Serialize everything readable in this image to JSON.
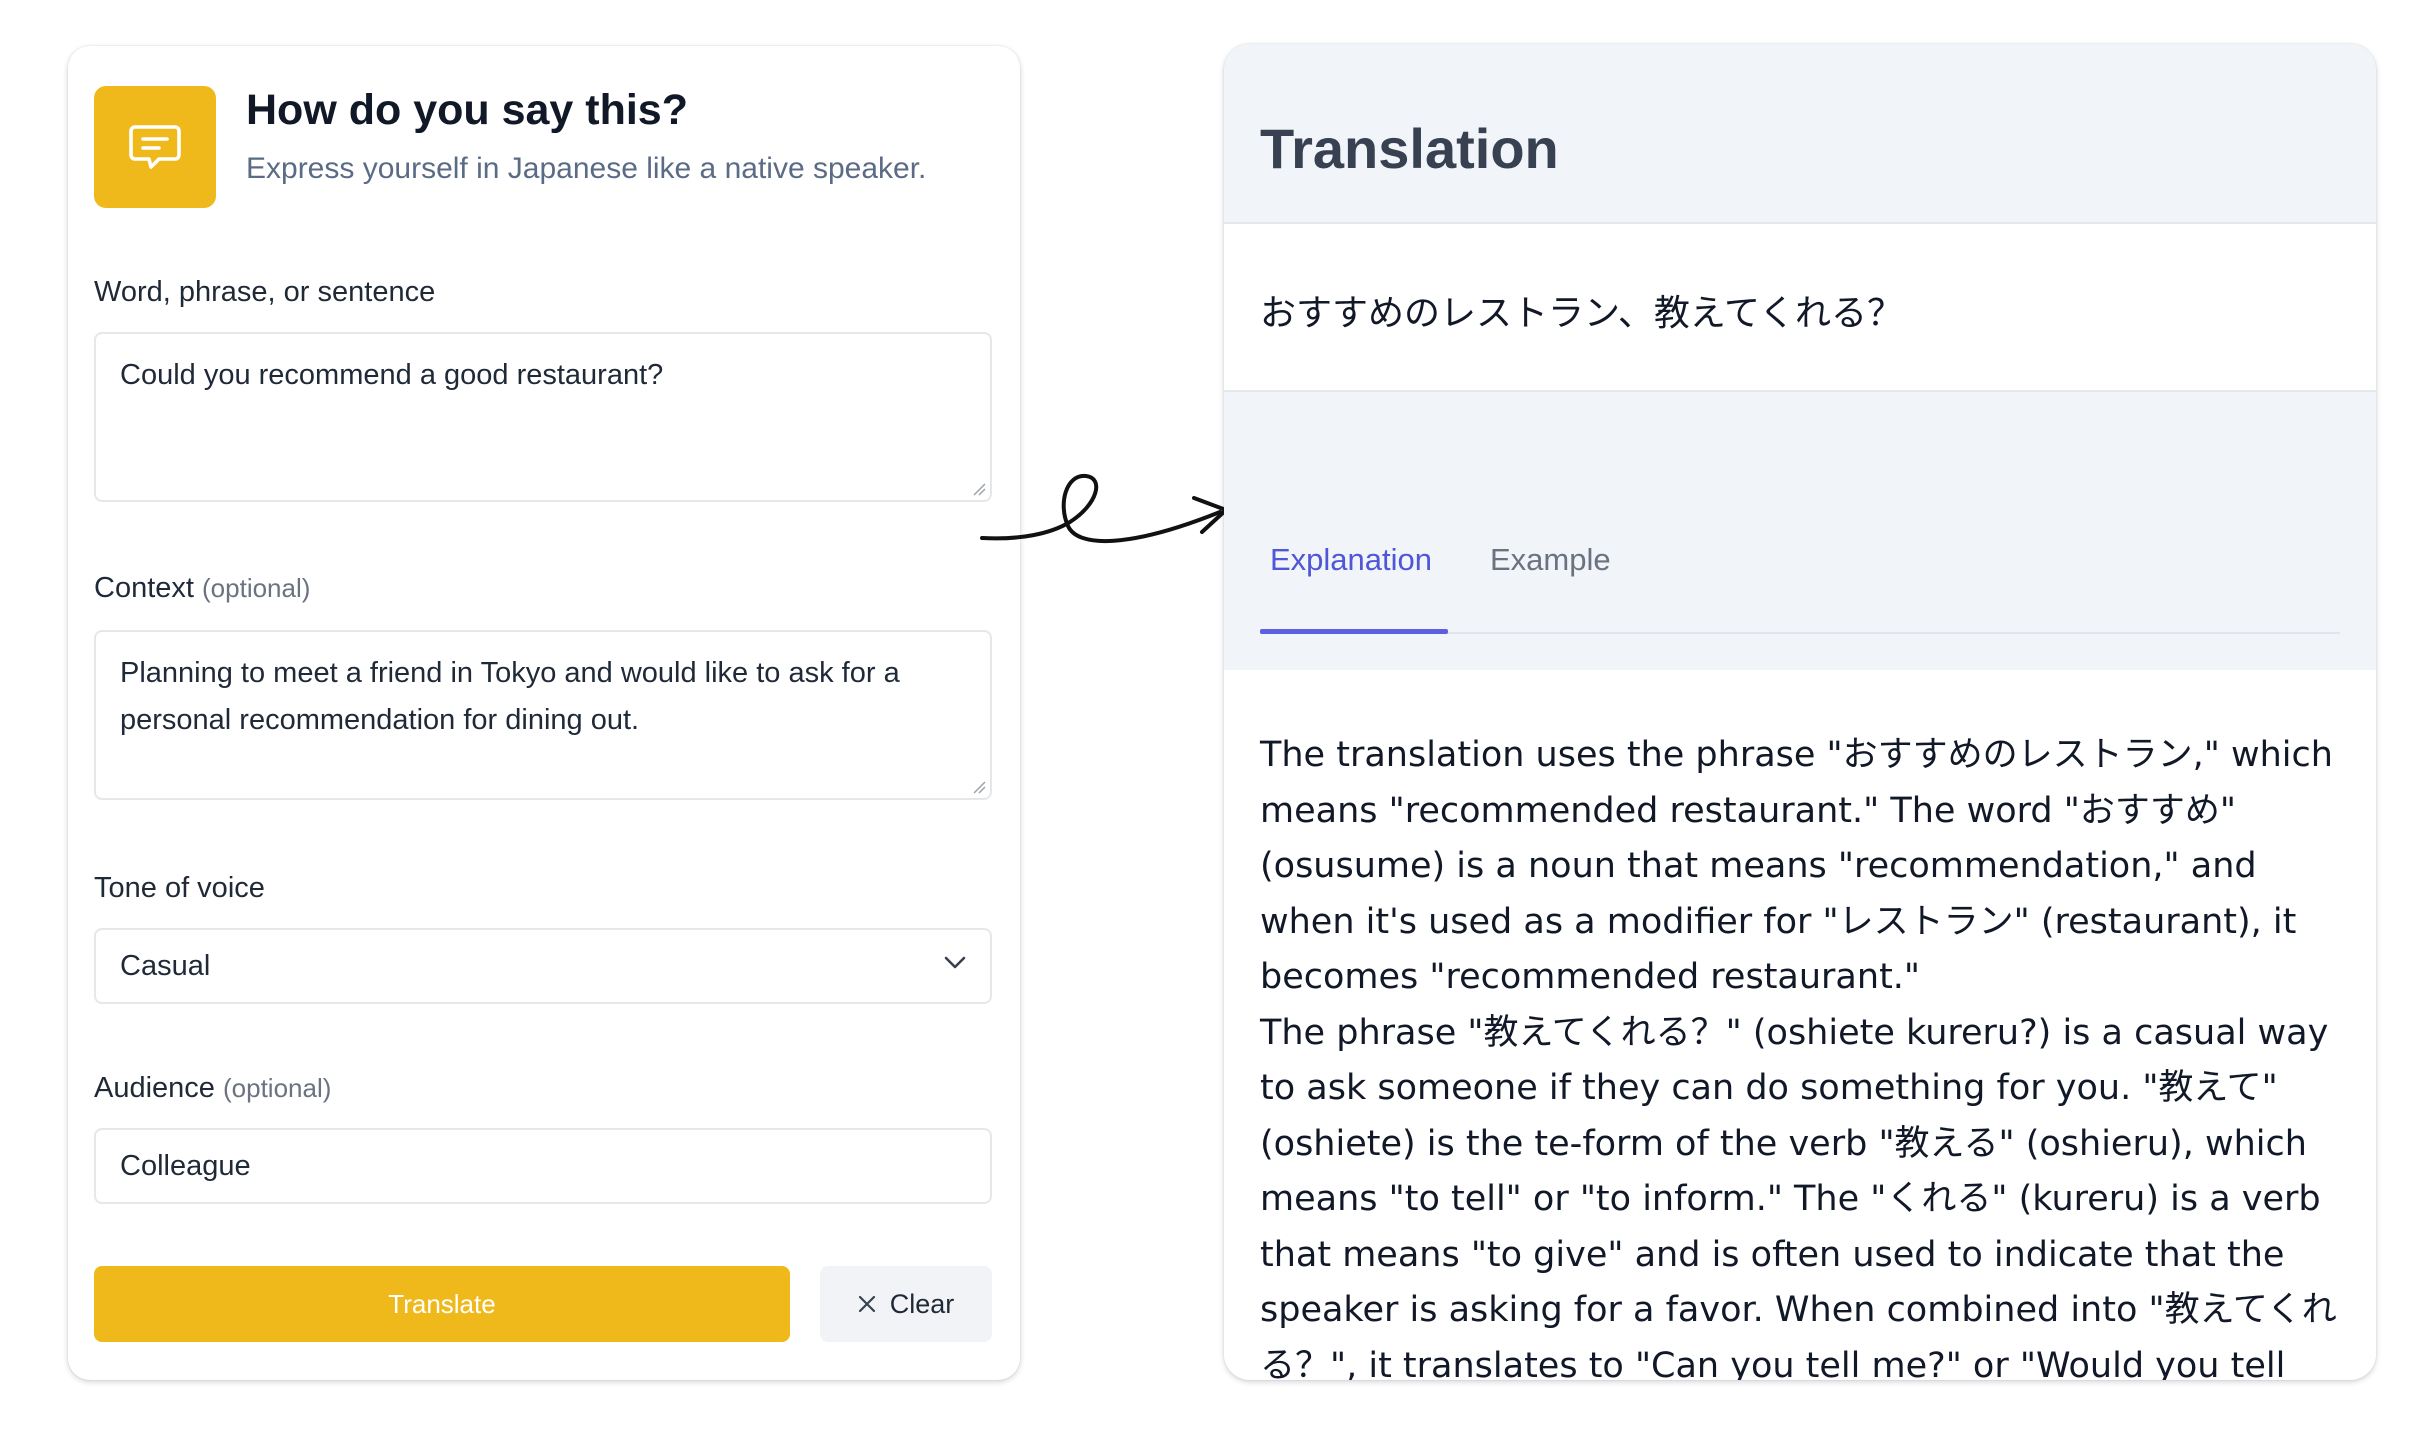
{
  "form": {
    "icon": "chat-bubble-icon",
    "title": "How do you say this?",
    "subtitle": "Express yourself in Japanese like a native speaker.",
    "phrase_label": "Word, phrase, or sentence",
    "phrase_value": "Could you recommend a good restaurant?",
    "context_label": "Context",
    "context_optional": "(optional)",
    "context_value": "Planning to meet a friend in Tokyo and would like to ask for a personal recommendation for dining out.",
    "tone_label": "Tone of voice",
    "tone_value": "Casual",
    "audience_label": "Audience",
    "audience_optional": "(optional)",
    "audience_value": "Colleague",
    "translate_label": "Translate",
    "clear_label": "Clear"
  },
  "result": {
    "title": "Translation",
    "translation": "おすすめのレストラン、教えてくれる？",
    "tabs": [
      {
        "label": "Explanation",
        "active": true
      },
      {
        "label": "Example",
        "active": false
      }
    ],
    "explanation": "The translation uses the phrase \"おすすめのレストラン,\" which means \"recommended restaurant.\" The word \"おすすめ\" (osusume) is a noun that means \"recommendation,\" and when it's used as a modifier for \"レストラン\" (restaurant), it becomes \"recommended restaurant.\"\nThe phrase \"教えてくれる？\" (oshiete kureru?) is a casual way to ask someone if they can do something for you. \"教えて\" (oshiete) is the te-form of the verb \"教える\" (oshieru), which means \"to tell\" or \"to inform.\" The \"くれる\" (kureru) is a verb that means \"to give\" and is often used to indicate that the speaker is asking for a favor. When combined into \"教えてくれる？\", it translates to \"Can you tell me?\" or \"Would you tell me?\" in a casual request form."
  },
  "colors": {
    "accent": "#f0b91b",
    "tab_active": "#4f56d8",
    "panel_bg": "#f1f4f8"
  }
}
